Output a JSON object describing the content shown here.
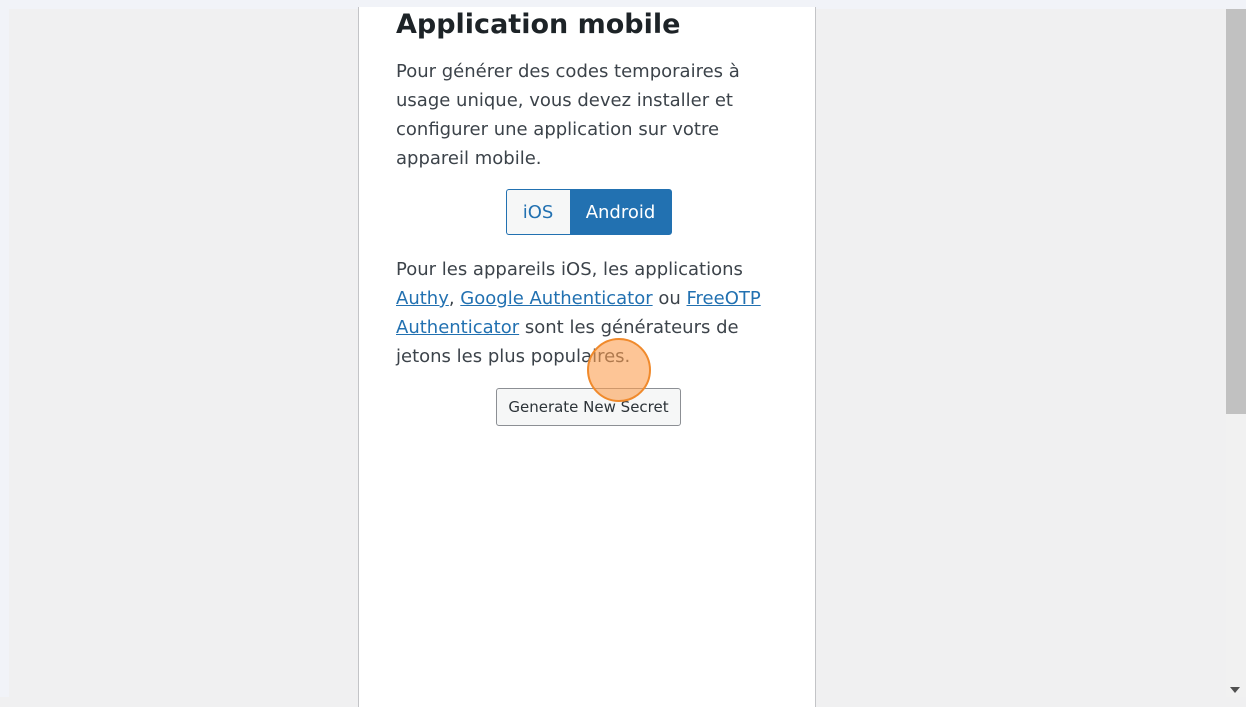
{
  "section": {
    "title": "Application mobile",
    "intro": "Pour générer des codes temporaires à usage unique, vous devez installer et configurer une application sur votre appareil mobile."
  },
  "tabs": [
    {
      "label": "iOS",
      "selected": false
    },
    {
      "label": "Android",
      "selected": true
    }
  ],
  "description": {
    "prefix": "Pour les appareils iOS, les applications ",
    "link_authy": "Authy",
    "sep1": ", ",
    "link_google": "Google Authenticator",
    "sep2": " ou ",
    "link_freeotp": "FreeOTP Authenticator",
    "suffix": " sont les générateurs de jetons les plus populaires."
  },
  "actions": {
    "generate_label": "Generate New Secret"
  },
  "colors": {
    "accent": "#2271b1",
    "click_marker": "#f08a2c"
  },
  "icons": {
    "scroll_down": "chevron-down-icon"
  }
}
